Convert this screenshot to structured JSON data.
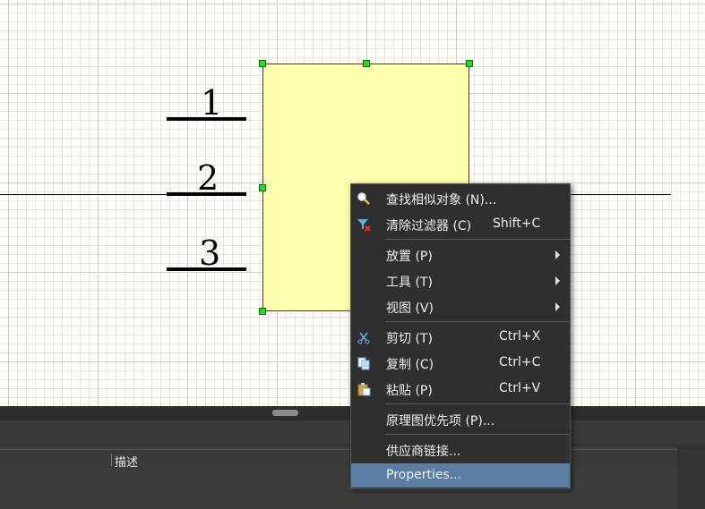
{
  "schematic": {
    "pins": [
      {
        "number": "1"
      },
      {
        "number": "2"
      },
      {
        "number": "3"
      }
    ],
    "component_fill": "#ffffb0",
    "selection_handle_color": "#22dd22"
  },
  "bottom_panel": {
    "columns": [
      "描述"
    ]
  },
  "context_menu": {
    "items": [
      {
        "label": "查找相似对象 (N)...",
        "shortcut": "",
        "icon": "magnifier-icon"
      },
      {
        "label": "清除过滤器 (C)",
        "shortcut": "Shift+C",
        "icon": "clear-filter-icon"
      },
      {
        "label": "放置 (P)",
        "submenu": true
      },
      {
        "label": "工具 (T)",
        "submenu": true
      },
      {
        "label": "视图 (V)",
        "submenu": true
      },
      {
        "label": "剪切 (T)",
        "shortcut": "Ctrl+X",
        "icon": "scissors-icon"
      },
      {
        "label": "复制 (C)",
        "shortcut": "Ctrl+C",
        "icon": "copy-icon"
      },
      {
        "label": "粘贴 (P)",
        "shortcut": "Ctrl+V",
        "icon": "paste-icon"
      },
      {
        "label": "原理图优先项 (P)..."
      },
      {
        "label": "供应商链接..."
      },
      {
        "label": "Properties..."
      }
    ],
    "highlight_color": "#5a7ea1"
  }
}
